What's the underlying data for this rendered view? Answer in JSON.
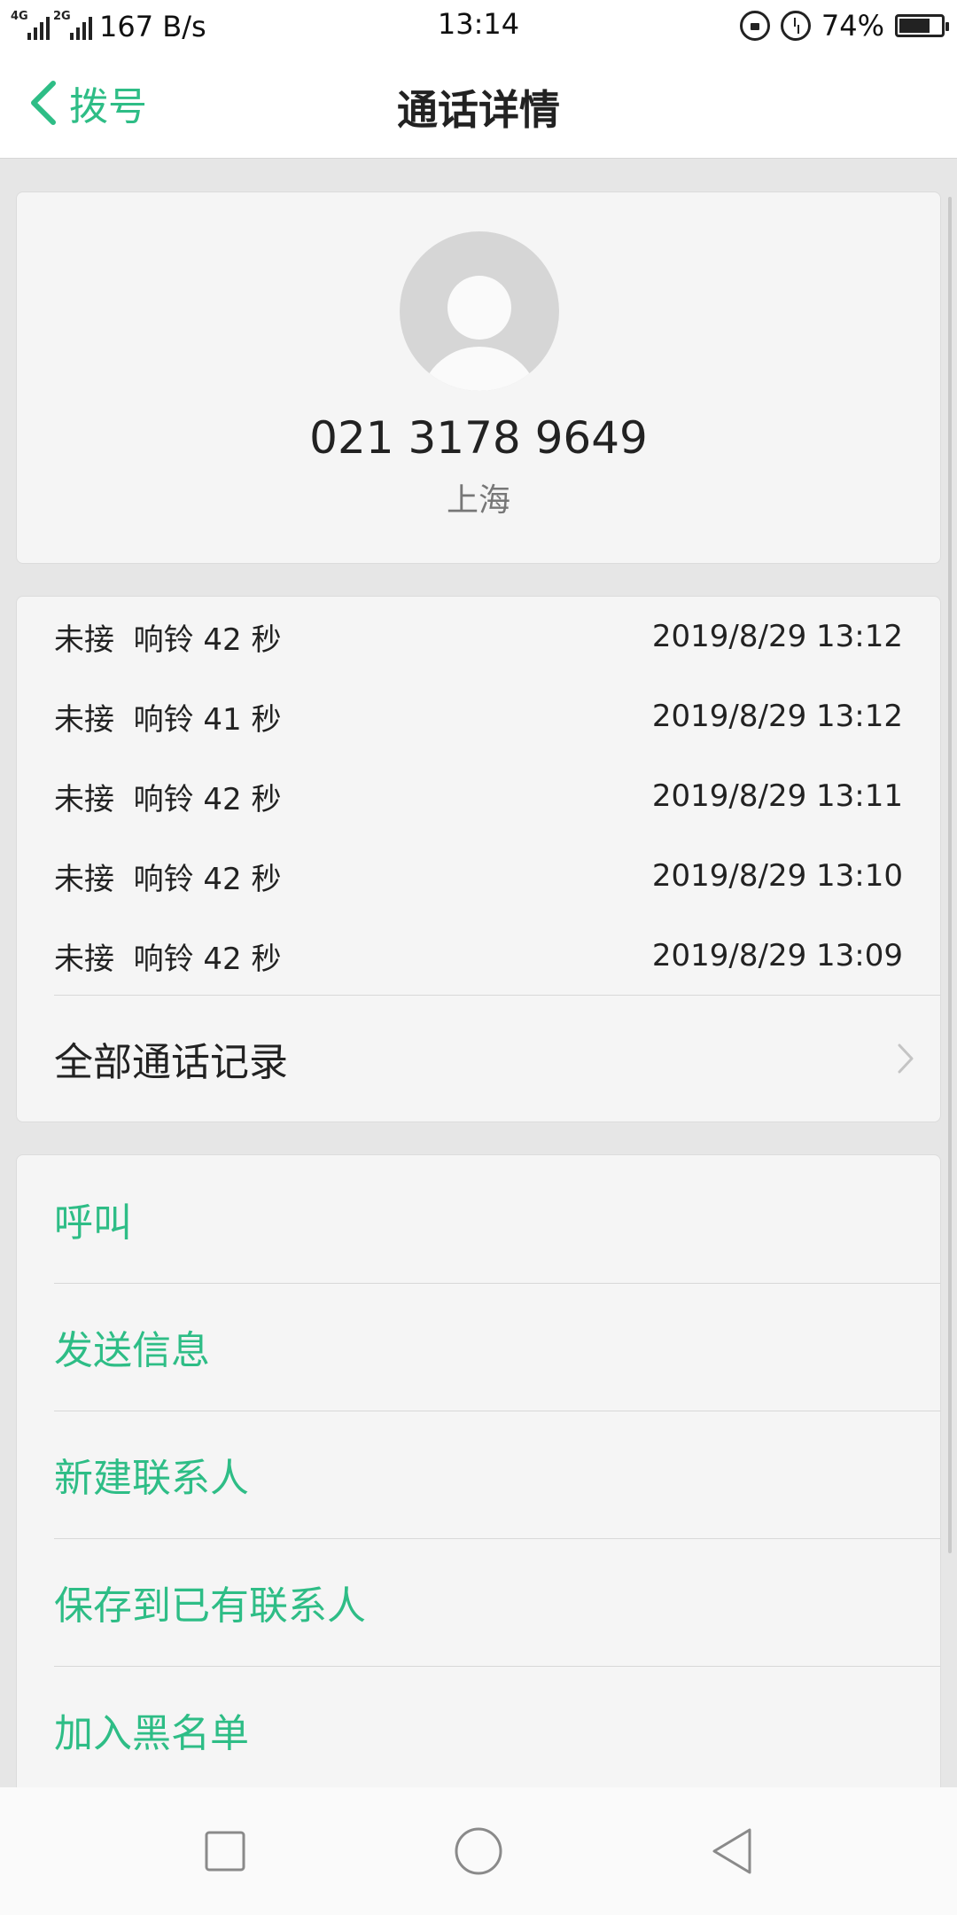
{
  "status_bar": {
    "network_1": "4G",
    "network_2": "2G",
    "speed": "167 B/s",
    "time": "13:14",
    "battery_text": "74%",
    "battery_level": 0.74,
    "icons": [
      "rotation-lock-icon",
      "alarm-icon",
      "battery-icon"
    ]
  },
  "header": {
    "back_label": "拨号",
    "title": "通话详情"
  },
  "contact": {
    "number": "021 3178 9649",
    "location": "上海"
  },
  "calls": [
    {
      "status": "未接  响铃 42 秒",
      "time": "2019/8/29 13:12"
    },
    {
      "status": "未接  响铃 41 秒",
      "time": "2019/8/29 13:12"
    },
    {
      "status": "未接  响铃 42 秒",
      "time": "2019/8/29 13:11"
    },
    {
      "status": "未接  响铃 42 秒",
      "time": "2019/8/29 13:10"
    },
    {
      "status": "未接  响铃 42 秒",
      "time": "2019/8/29 13:09"
    }
  ],
  "all_calls_label": "全部通话记录",
  "actions": {
    "call": "呼叫",
    "message": "发送信息",
    "new_contact": "新建联系人",
    "save_existing": "保存到已有联系人",
    "blacklist": "加入黑名单"
  },
  "colors": {
    "accent": "#2ebd86",
    "background": "#e6e6e6",
    "card": "#f5f5f5"
  }
}
